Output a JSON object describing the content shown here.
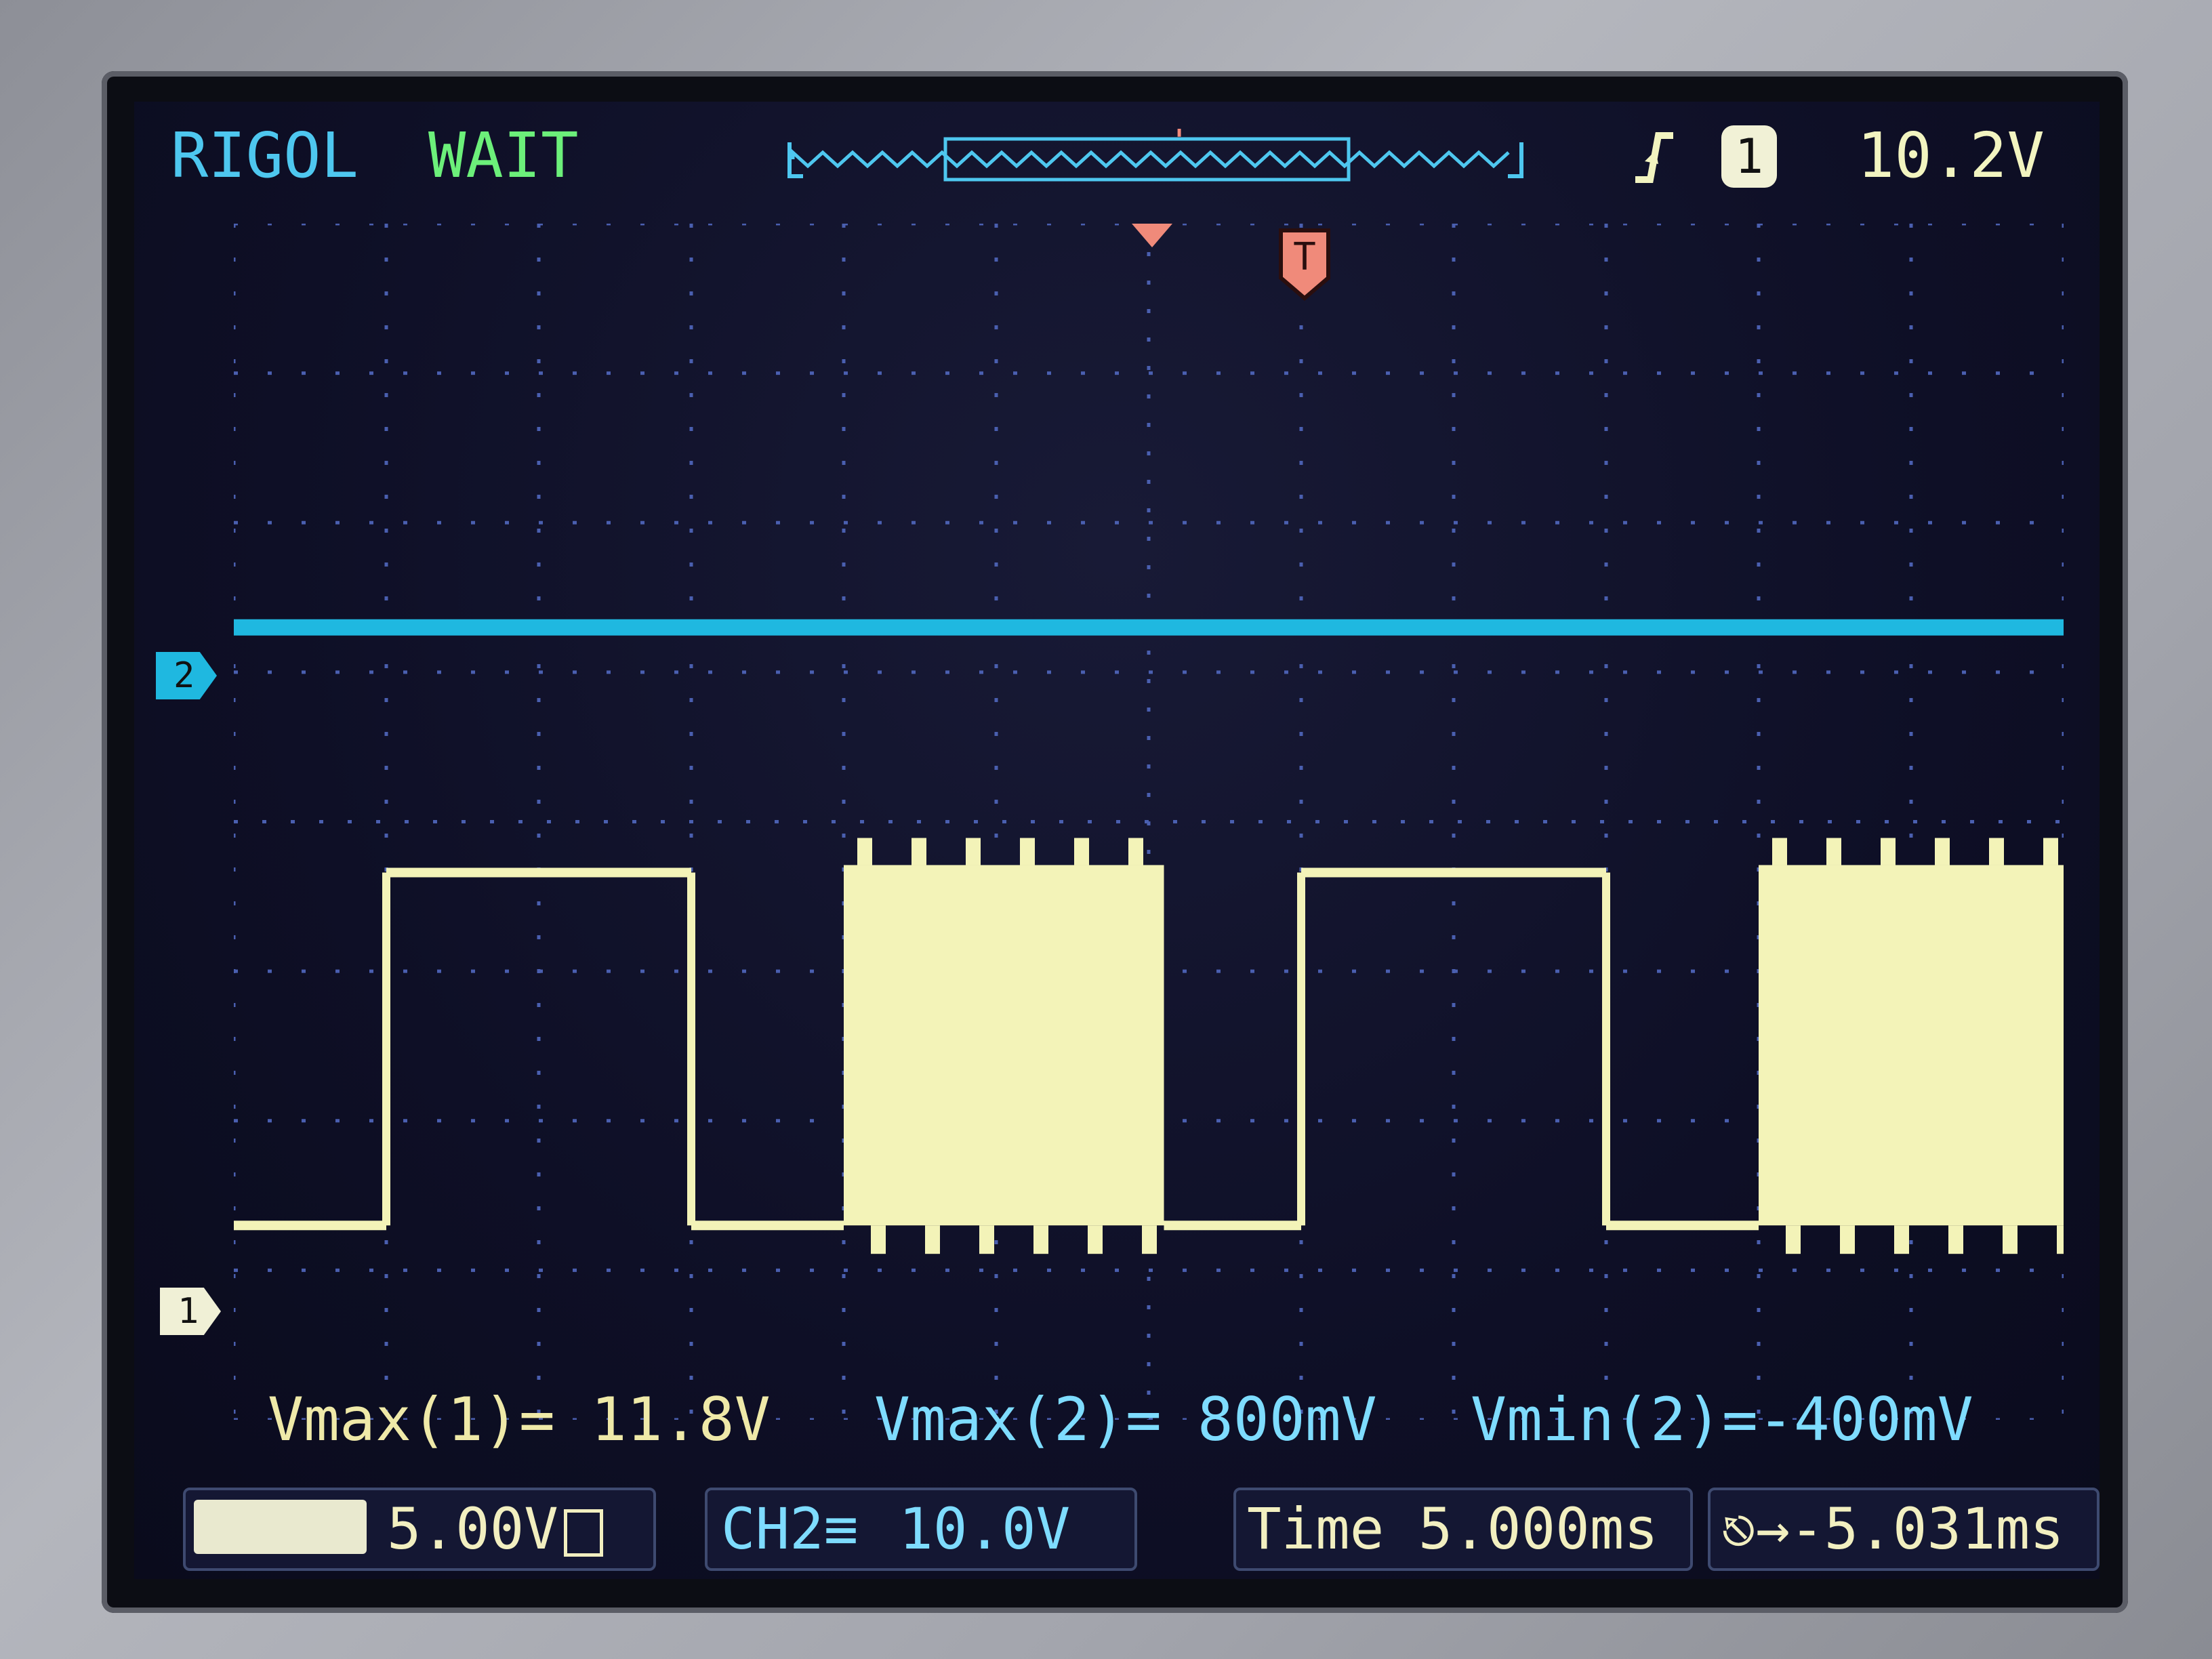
{
  "header": {
    "brand": "RIGOL",
    "state": "WAIT",
    "trigger_source": "1",
    "trigger_level": "10.2V",
    "trigger_icon": "rising-edge-icon"
  },
  "markers": {
    "ch2": "2",
    "ch1": "1"
  },
  "measurements": [
    {
      "label": "Vmax(1)=",
      "value": " 11.8V"
    },
    {
      "label": "Vmax(2)=",
      "value": " 800mV"
    },
    {
      "label": "Vmin(2)=",
      "value": "-400mV"
    }
  ],
  "status": {
    "ch1_scale": "5.00V",
    "ch2_label": "CH2",
    "ch2_coupling_icon": "dc-coupling-icon",
    "ch2_scale": "10.0V",
    "time_label": "Time",
    "time_scale": "5.000ms",
    "trigger_offset_icon": "trigger-position-icon",
    "trigger_offset": "-5.031ms"
  },
  "colors": {
    "ch1": "#f3f3b8",
    "ch2": "#1fb8e0",
    "grid": "#4a5fb0",
    "trigger_marker": "#f08a7a"
  },
  "chart_data": {
    "type": "line",
    "x_unit": "ms",
    "xlim": [
      -30,
      30
    ],
    "grid": true,
    "series": [
      {
        "channel": "1",
        "volts_per_div": 5.0,
        "segments": [
          {
            "x": [
              -30,
              -25
            ],
            "kind": "low"
          },
          {
            "x": [
              -25,
              -15
            ],
            "kind": "high"
          },
          {
            "x": [
              -15,
              -10
            ],
            "kind": "low"
          },
          {
            "x": [
              -10,
              0.5
            ],
            "kind": "pwm"
          },
          {
            "x": [
              0.5,
              5
            ],
            "kind": "low"
          },
          {
            "x": [
              5,
              15
            ],
            "kind": "high"
          },
          {
            "x": [
              15,
              20
            ],
            "kind": "low"
          },
          {
            "x": [
              20,
              30
            ],
            "kind": "pwm"
          }
        ],
        "vmax": 11.8
      },
      {
        "channel": "2",
        "volts_per_div": 10.0,
        "level": 0.0,
        "vmax": 0.8,
        "vmin": -0.4
      }
    ]
  }
}
